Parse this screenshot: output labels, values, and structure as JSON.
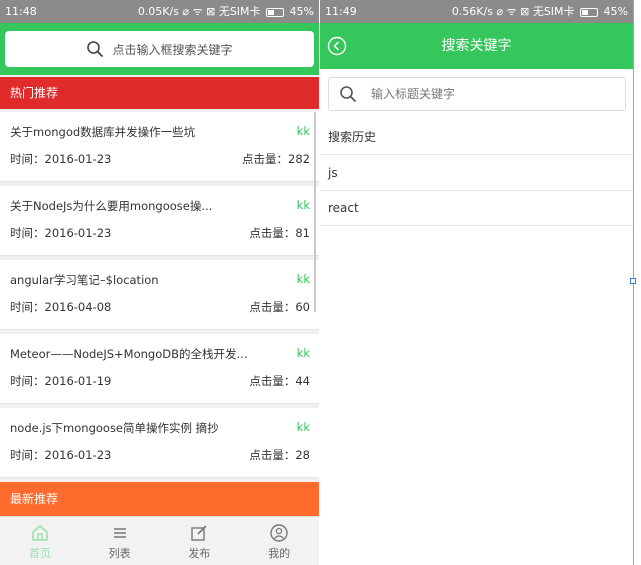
{
  "left": {
    "status": {
      "time": "11:48",
      "right": "0.05K/s ⌀ ᯤ ⊠ 无SIM卡",
      "battery": "45%"
    },
    "search_placeholder": "点击输入框搜索关键字",
    "hot_label": "热门推荐",
    "articles": [
      {
        "title": "关于mongod数据库并发操作一些坑",
        "author": "kk",
        "time": "时间：2016-01-23",
        "clicks": "点击量：282"
      },
      {
        "title": "关于NodeJs为什么要用mongoose操...",
        "author": "kk",
        "time": "时间：2016-01-23",
        "clicks": "点击量：81"
      },
      {
        "title": "angular学习笔记–$location",
        "author": "kk",
        "time": "时间：2016-04-08",
        "clicks": "点击量：60"
      },
      {
        "title": "Meteor——NodeJS+MongoDB的全栈开发...",
        "author": "kk",
        "time": "时间：2016-01-19",
        "clicks": "点击量：44"
      },
      {
        "title": "node.js下mongoose简单操作实例      摘抄",
        "author": "kk",
        "time": "时间：2016-01-23",
        "clicks": "点击量：28"
      }
    ],
    "new_label": "最新推荐",
    "tabs": [
      {
        "label": "首页",
        "icon": "home-icon",
        "active": true
      },
      {
        "label": "列表",
        "icon": "list-icon",
        "active": false
      },
      {
        "label": "发布",
        "icon": "edit-icon",
        "active": false
      },
      {
        "label": "我的",
        "icon": "user-icon",
        "active": false
      }
    ]
  },
  "right": {
    "status": {
      "time": "11:49",
      "right": "0.56K/s ⌀ ᯤ ⊠ 无SIM卡",
      "battery": "45%"
    },
    "title": "搜索关键字",
    "search_placeholder": "输入标题关键字",
    "history_label": "搜索历史",
    "history": [
      "js",
      "react"
    ]
  },
  "colors": {
    "green": "#36c75c",
    "hot_red": "#e02b2b",
    "new_orange": "#ff6a2d",
    "author_green": "#36c75c"
  }
}
